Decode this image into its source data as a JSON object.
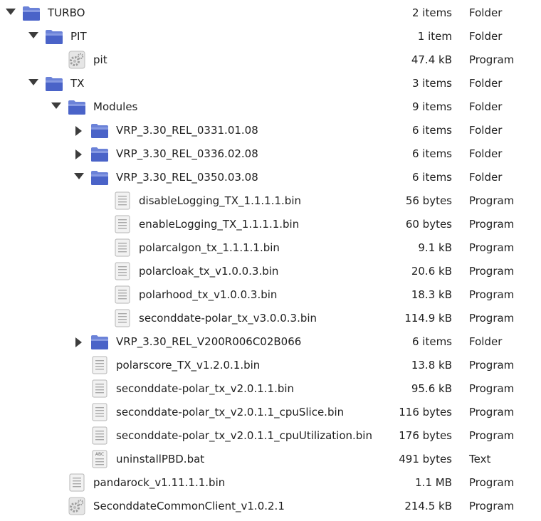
{
  "rows": [
    {
      "depth": 0,
      "expander": "open",
      "icon": "folder",
      "name": "TURBO",
      "size": "2 items",
      "type": "Folder"
    },
    {
      "depth": 1,
      "expander": "open",
      "icon": "folder",
      "name": "PIT",
      "size": "1 item",
      "type": "Folder"
    },
    {
      "depth": 2,
      "expander": "none",
      "icon": "gear-program",
      "name": "pit",
      "size": "47.4 kB",
      "type": "Program"
    },
    {
      "depth": 1,
      "expander": "open",
      "icon": "folder",
      "name": "TX",
      "size": "3 items",
      "type": "Folder"
    },
    {
      "depth": 2,
      "expander": "open",
      "icon": "folder",
      "name": "Modules",
      "size": "9 items",
      "type": "Folder"
    },
    {
      "depth": 3,
      "expander": "closed",
      "icon": "folder",
      "name": "VRP_3.30_REL_0331.01.08",
      "size": "6 items",
      "type": "Folder"
    },
    {
      "depth": 3,
      "expander": "closed",
      "icon": "folder",
      "name": "VRP_3.30_REL_0336.02.08",
      "size": "6 items",
      "type": "Folder"
    },
    {
      "depth": 3,
      "expander": "open",
      "icon": "folder",
      "name": "VRP_3.30_REL_0350.03.08",
      "size": "6 items",
      "type": "Folder"
    },
    {
      "depth": 4,
      "expander": "none",
      "icon": "binary-file",
      "name": "disableLogging_TX_1.1.1.1.bin",
      "size": "56 bytes",
      "type": "Program"
    },
    {
      "depth": 4,
      "expander": "none",
      "icon": "binary-file",
      "name": "enableLogging_TX_1.1.1.1.bin",
      "size": "60 bytes",
      "type": "Program"
    },
    {
      "depth": 4,
      "expander": "none",
      "icon": "binary-file",
      "name": "polarcalgon_tx_1.1.1.1.bin",
      "size": "9.1 kB",
      "type": "Program"
    },
    {
      "depth": 4,
      "expander": "none",
      "icon": "binary-file",
      "name": "polarcloak_tx_v1.0.0.3.bin",
      "size": "20.6 kB",
      "type": "Program"
    },
    {
      "depth": 4,
      "expander": "none",
      "icon": "binary-file",
      "name": "polarhood_tx_v1.0.0.3.bin",
      "size": "18.3 kB",
      "type": "Program"
    },
    {
      "depth": 4,
      "expander": "none",
      "icon": "binary-file",
      "name": "seconddate-polar_tx_v3.0.0.3.bin",
      "size": "114.9 kB",
      "type": "Program"
    },
    {
      "depth": 3,
      "expander": "closed",
      "icon": "folder",
      "name": "VRP_3.30_REL_V200R006C02B066",
      "size": "6 items",
      "type": "Folder"
    },
    {
      "depth": 3,
      "expander": "none",
      "icon": "binary-file",
      "name": "polarscore_TX_v1.2.0.1.bin",
      "size": "13.8 kB",
      "type": "Program"
    },
    {
      "depth": 3,
      "expander": "none",
      "icon": "binary-file",
      "name": "seconddate-polar_tx_v2.0.1.1.bin",
      "size": "95.6 kB",
      "type": "Program"
    },
    {
      "depth": 3,
      "expander": "none",
      "icon": "binary-file",
      "name": "seconddate-polar_tx_v2.0.1.1_cpuSlice.bin",
      "size": "116 bytes",
      "type": "Program"
    },
    {
      "depth": 3,
      "expander": "none",
      "icon": "binary-file",
      "name": "seconddate-polar_tx_v2.0.1.1_cpuUtilization.bin",
      "size": "176 bytes",
      "type": "Program"
    },
    {
      "depth": 3,
      "expander": "none",
      "icon": "text-file",
      "name": "uninstallPBD.bat",
      "size": "491 bytes",
      "type": "Text"
    },
    {
      "depth": 2,
      "expander": "none",
      "icon": "binary-file",
      "name": "pandarock_v1.11.1.1.bin",
      "size": "1.1 MB",
      "type": "Program"
    },
    {
      "depth": 2,
      "expander": "none",
      "icon": "gear-program",
      "name": "SeconddateCommonClient_v1.0.2.1",
      "size": "214.5 kB",
      "type": "Program"
    }
  ],
  "icon_labels": {
    "text-file": "ABC"
  },
  "colors": {
    "folder_body": "#4a63c8",
    "folder_tab": "#6b82d8",
    "folder_top": "#9fb0ec",
    "file_bg": "#f2f2f2",
    "file_border": "#b5b5b5"
  }
}
